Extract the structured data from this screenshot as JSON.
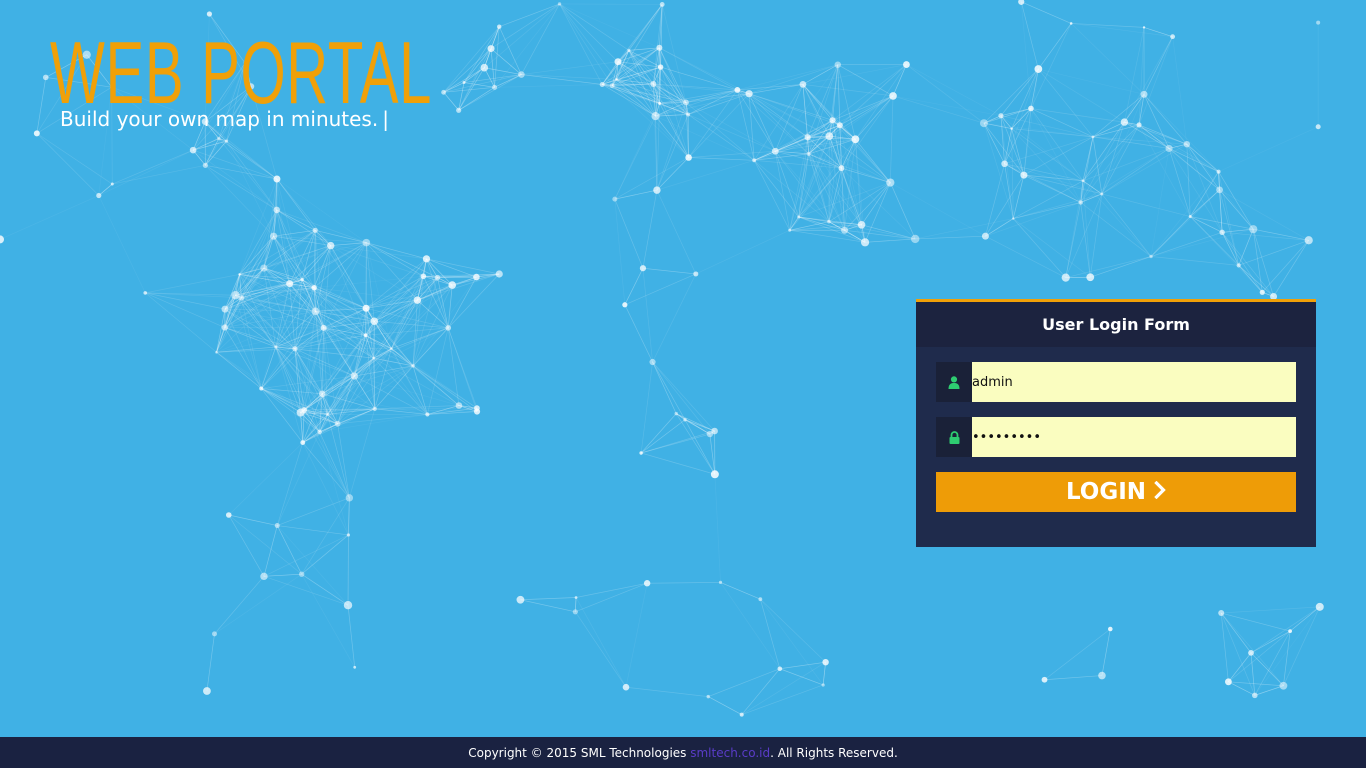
{
  "brand": {
    "title": "WEB PORTAL",
    "tagline": "Build your own map in minutes.",
    "cursor": "|"
  },
  "login_form": {
    "title": "User Login Form",
    "username_value": "admin",
    "password_value": "passwords",
    "username_icon": "user-icon",
    "password_icon": "lock-icon",
    "login_label": "LOGIN",
    "login_icon": "chevron-right-icon"
  },
  "footer": {
    "prefix": "Copyright © 2015 SML Technologies ",
    "link_text": "smltech.co.id",
    "suffix": ". All Rights Reserved."
  },
  "colors": {
    "background": "#40b1e5",
    "accent": "#f0a008",
    "panel": "#1f2b4c",
    "input_background": "#fafdc0",
    "icon_green": "#2ecc71",
    "footer_background": "#1a2241"
  }
}
